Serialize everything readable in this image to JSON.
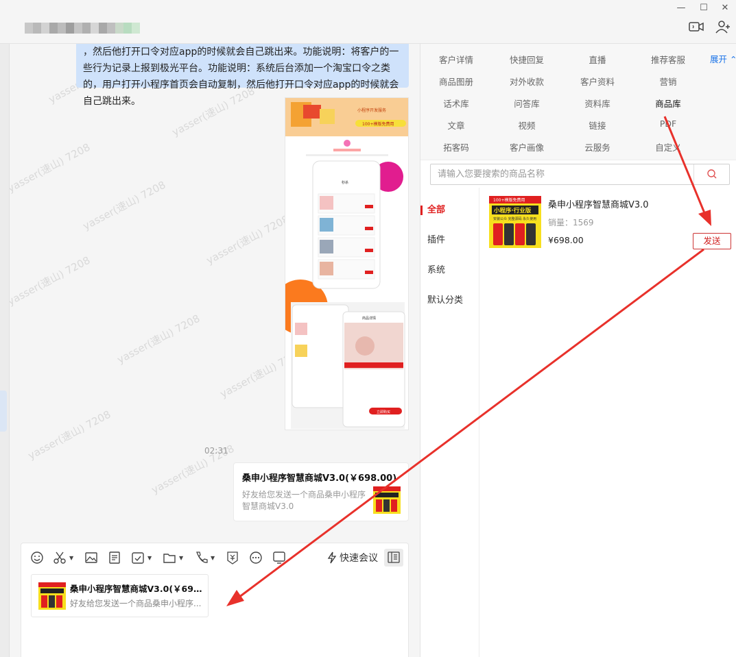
{
  "window": {
    "contact_name_blurred": "",
    "minimize_glyph": "—",
    "maximize_glyph": "☐",
    "close_glyph": "✕",
    "header_icons": [
      "video-call-icon",
      "add-member-icon"
    ]
  },
  "chat": {
    "incoming_text": "，然后他打开口令对应app的时候就会自己跳出来。功能说明：将客户的一些行为记录上报到极光平台。功能说明：系统后台添加一个淘宝口令之类的，用户打开小程序首页会自动复制，然后他打开口令对应app的时候就会自己跳出来。",
    "timestamp": "02:31",
    "watermark_text": "yasser(速山) 7208",
    "poster": {
      "banner_small": "小程序开发服务",
      "banner_badge": "100+模版免费用",
      "phone_title": "秒杀",
      "detail_title": "商品详情",
      "cart_button": "立即购买"
    },
    "product_card": {
      "title": "桑申小程序智慧商城V3.0(￥698.00)",
      "description": "好友给您发送一个商品桑申小程序智慧商城V3.0"
    }
  },
  "composer": {
    "tools": [
      "emoji-icon",
      "scissors-icon",
      "image-icon",
      "document-icon",
      "schedule-icon",
      "folder-icon",
      "phone-icon",
      "redpacket-icon",
      "more-icon",
      "screen-icon"
    ],
    "quick_meeting_label": "快速会议",
    "draft": {
      "title": "桑申小程序智慧商城V3.0(￥698....",
      "description": "好友给您发送一个商品桑申小程序..."
    }
  },
  "rpanel": {
    "grid": [
      [
        "客户详情",
        "快捷回复",
        "直播",
        "推荐客服"
      ],
      [
        "商品图册",
        "对外收款",
        "客户资料",
        "营销"
      ],
      [
        "话术库",
        "问答库",
        "资料库",
        "商品库"
      ],
      [
        "文章",
        "视频",
        "链接",
        "PDF"
      ],
      [
        "拓客码",
        "客户画像",
        "云服务",
        "自定义"
      ]
    ],
    "active_item": "商品库",
    "expand_label": "展开 ⌃",
    "search_placeholder": "请输入您要搜索的商品名称",
    "categories": [
      "全部",
      "插件",
      "系统",
      "默认分类"
    ],
    "product": {
      "name": "桑申小程序智慧商城V3.0",
      "sales": "销量：1569",
      "price": "¥698.00",
      "send_label": "发送",
      "thumb_banner": "100+模版免费用",
      "thumb_title": "小程序·行业版",
      "thumb_sub": "安装公众 完整源码 永久使用"
    }
  },
  "colors": {
    "accent_red": "#e02020",
    "bubble_blue": "#cfe2fb",
    "link_blue": "#1a73e8",
    "annotation_red": "#e8312b"
  }
}
